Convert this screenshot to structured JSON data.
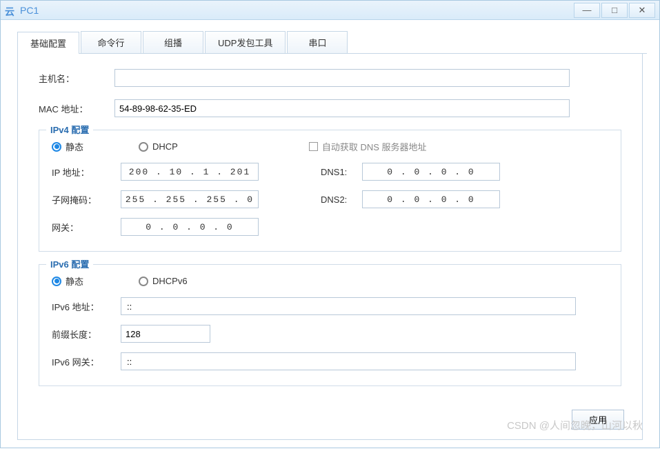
{
  "window": {
    "title": "PC1"
  },
  "tabs": [
    "基础配置",
    "命令行",
    "组播",
    "UDP发包工具",
    "串口"
  ],
  "hostname": {
    "label": "主机名：",
    "value": ""
  },
  "mac": {
    "label": "MAC 地址：",
    "value": "54-89-98-62-35-ED"
  },
  "ipv4": {
    "legend": "IPv4 配置",
    "radio_static": "静态",
    "radio_dhcp": "DHCP",
    "auto_dns": "自动获取 DNS 服务器地址",
    "ip_label": "IP 地址：",
    "ip_value": "200 . 10  .  1  . 201",
    "mask_label": "子网掩码：",
    "mask_value": "255 . 255 . 255 .  0",
    "gw_label": "网关：",
    "gw_value": "0  .  0  .  0  .  0",
    "dns1_label": "DNS1:",
    "dns1_value": "0  .  0  .  0  .  0",
    "dns2_label": "DNS2:",
    "dns2_value": "0  .  0  .  0  .  0"
  },
  "ipv6": {
    "legend": "IPv6 配置",
    "radio_static": "静态",
    "radio_dhcpv6": "DHCPv6",
    "addr_label": "IPv6 地址：",
    "addr_value": "::",
    "prefix_label": "前缀长度：",
    "prefix_value": "128",
    "gw_label": "IPv6 网关：",
    "gw_value": "::"
  },
  "apply": "应用",
  "watermark": "CSDN @人间忽晚，山河以秋"
}
